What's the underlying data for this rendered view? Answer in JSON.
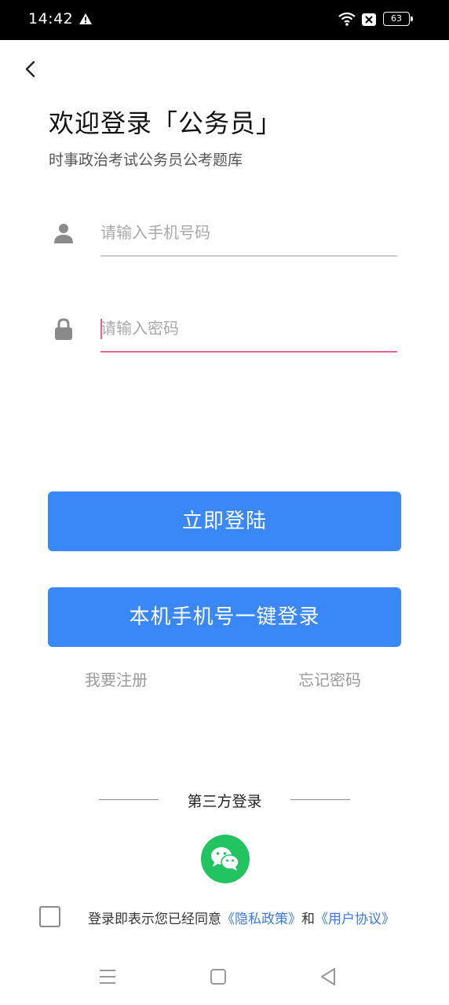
{
  "status_bar": {
    "time": "14:42",
    "battery": "63",
    "icons": [
      "alert-icon",
      "wifi-icon",
      "sim-off-icon",
      "battery-icon"
    ]
  },
  "header": {
    "back_icon": "chevron-left-icon",
    "title": "欢迎登录「公务员」",
    "subtitle": "时事政治考试公务员公考题库"
  },
  "form": {
    "phone_placeholder": "请输入手机号码",
    "phone_value": "",
    "phone_icon": "user-icon",
    "password_placeholder": "请输入密码",
    "password_value": "",
    "password_icon": "lock-icon"
  },
  "buttons": {
    "login": "立即登陆",
    "one_key_login": "本机手机号一键登录"
  },
  "links": {
    "register": "我要注册",
    "forgot_password": "忘记密码"
  },
  "third_party": {
    "label": "第三方登录",
    "wechat_icon": "wechat-icon"
  },
  "agreement": {
    "prefix": "登录即表示您已经同意",
    "privacy_policy": "《隐私政策》",
    "conjunction": "和",
    "user_agreement": "《用户协议》",
    "checked": false
  },
  "navigation_bar": {
    "icons": [
      "menu-icon",
      "home-icon",
      "back-triangle-icon"
    ]
  },
  "colors": {
    "primary": "#3a87f7",
    "focus_underline": "#e8628a",
    "link": "#3a78e0",
    "wechat": "#21c461"
  }
}
